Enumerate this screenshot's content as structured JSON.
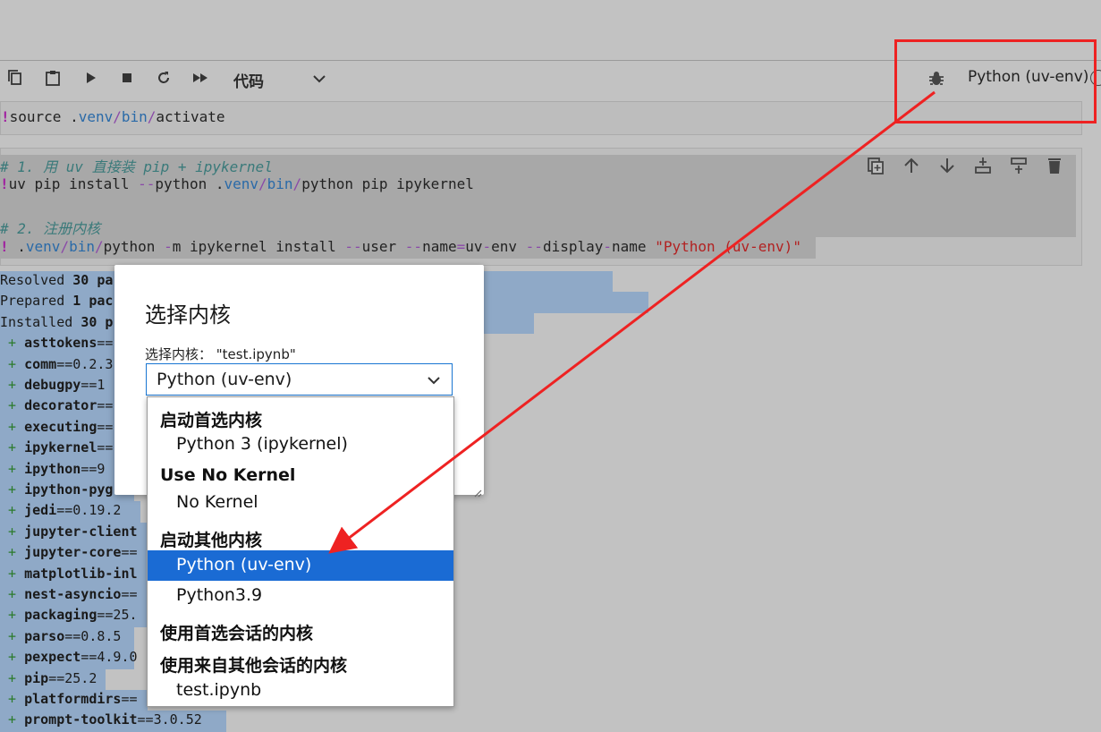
{
  "toolbar": {
    "cell_type": "代码",
    "kernel_name": "Python (uv-env)",
    "icons": [
      "copy-icon",
      "paste-icon",
      "run-icon",
      "stop-icon",
      "restart-icon",
      "run-all-icon",
      "chevron-down-icon",
      "bug-icon",
      "kernel-status-icon"
    ]
  },
  "cell1": {
    "bang": "!",
    "text_a": "source .",
    "path1": "venv",
    "sep1": "/",
    "path2": "bin",
    "sep2": "/",
    "text_b": "activate"
  },
  "cell2": {
    "comment1": "# 1. 用 uv 直接装 pip + ipykernel",
    "line2_bang": "!",
    "line2_a": "uv pip install ",
    "line2_op": "--",
    "line2_b": "python .",
    "line2_path": "venv",
    "line2_sep1": "/",
    "line2_bin": "bin",
    "line2_sep2": "/",
    "line2_c": "python pip ipykernel",
    "comment2": "# 2. 注册内核",
    "line4_bang": "!",
    "line4_a": " .",
    "line4_path": "venv",
    "line4_sep1": "/",
    "line4_bin": "bin",
    "line4_sep2": "/",
    "line4_b": "python ",
    "line4_op1": "-",
    "line4_c": "m ipykernel install ",
    "line4_op2": "--",
    "line4_d": "user ",
    "line4_op3": "--",
    "line4_e": "name",
    "line4_eq": "=",
    "line4_f": "uv",
    "line4_op4": "-",
    "line4_g": "env ",
    "line4_op5": "--",
    "line4_h": "display",
    "line4_op6": "-",
    "line4_i": "name ",
    "line4_str": "\"Python (uv-env)\""
  },
  "output": {
    "resolved_a": "Resolved ",
    "resolved_b": "30 pa",
    "prepared_a": "Prepared ",
    "prepared_b": "1 pac",
    "installed_a": "Installed ",
    "installed_b": "30 p",
    "packages": [
      {
        "name": "asttokens",
        "rest": "=="
      },
      {
        "name": "comm",
        "rest": "==0.2.3"
      },
      {
        "name": "debugpy",
        "rest": "==1"
      },
      {
        "name": "decorator",
        "rest": "=="
      },
      {
        "name": "executing",
        "rest": "=="
      },
      {
        "name": "ipykernel",
        "rest": "=="
      },
      {
        "name": "ipython",
        "rest": "==9"
      },
      {
        "name": "ipython-pyg",
        "rest": ""
      },
      {
        "name": "jedi",
        "rest": "==0.19.2"
      },
      {
        "name": "jupyter-client",
        "rest": ""
      },
      {
        "name": "jupyter-core",
        "rest": "=="
      },
      {
        "name": "matplotlib-inl",
        "rest": ""
      },
      {
        "name": "nest-asyncio",
        "rest": "=="
      },
      {
        "name": "packaging",
        "rest": "==25."
      },
      {
        "name": "parso",
        "rest": "==0.8.5"
      },
      {
        "name": "pexpect",
        "rest": "==4.9.0"
      },
      {
        "name": "pip",
        "rest": "==25.2"
      },
      {
        "name": "platformdirs",
        "rest": "=="
      },
      {
        "name": "prompt-toolkit",
        "rest": "==3.0.52"
      }
    ],
    "plus": "+"
  },
  "dialog": {
    "title": "选择内核",
    "label": "选择内核：  \"test.ipynb\"",
    "selected_value": "Python (uv-env)"
  },
  "dropdown": {
    "group1": "启动首选内核",
    "opt1": "Python 3 (ipykernel)",
    "group2": "Use No Kernel",
    "opt2": "No Kernel",
    "group3": "启动其他内核",
    "opt3": "Python (uv-env)",
    "opt4": "Python3.9",
    "group4": "使用首选会话的内核",
    "group5": "使用来自其他会话的内核",
    "opt5": "test.ipynb"
  },
  "colors": {
    "annotation": "#ee2222",
    "selection": "#1a6bd4",
    "output_highlight": "#8fa9c7"
  }
}
